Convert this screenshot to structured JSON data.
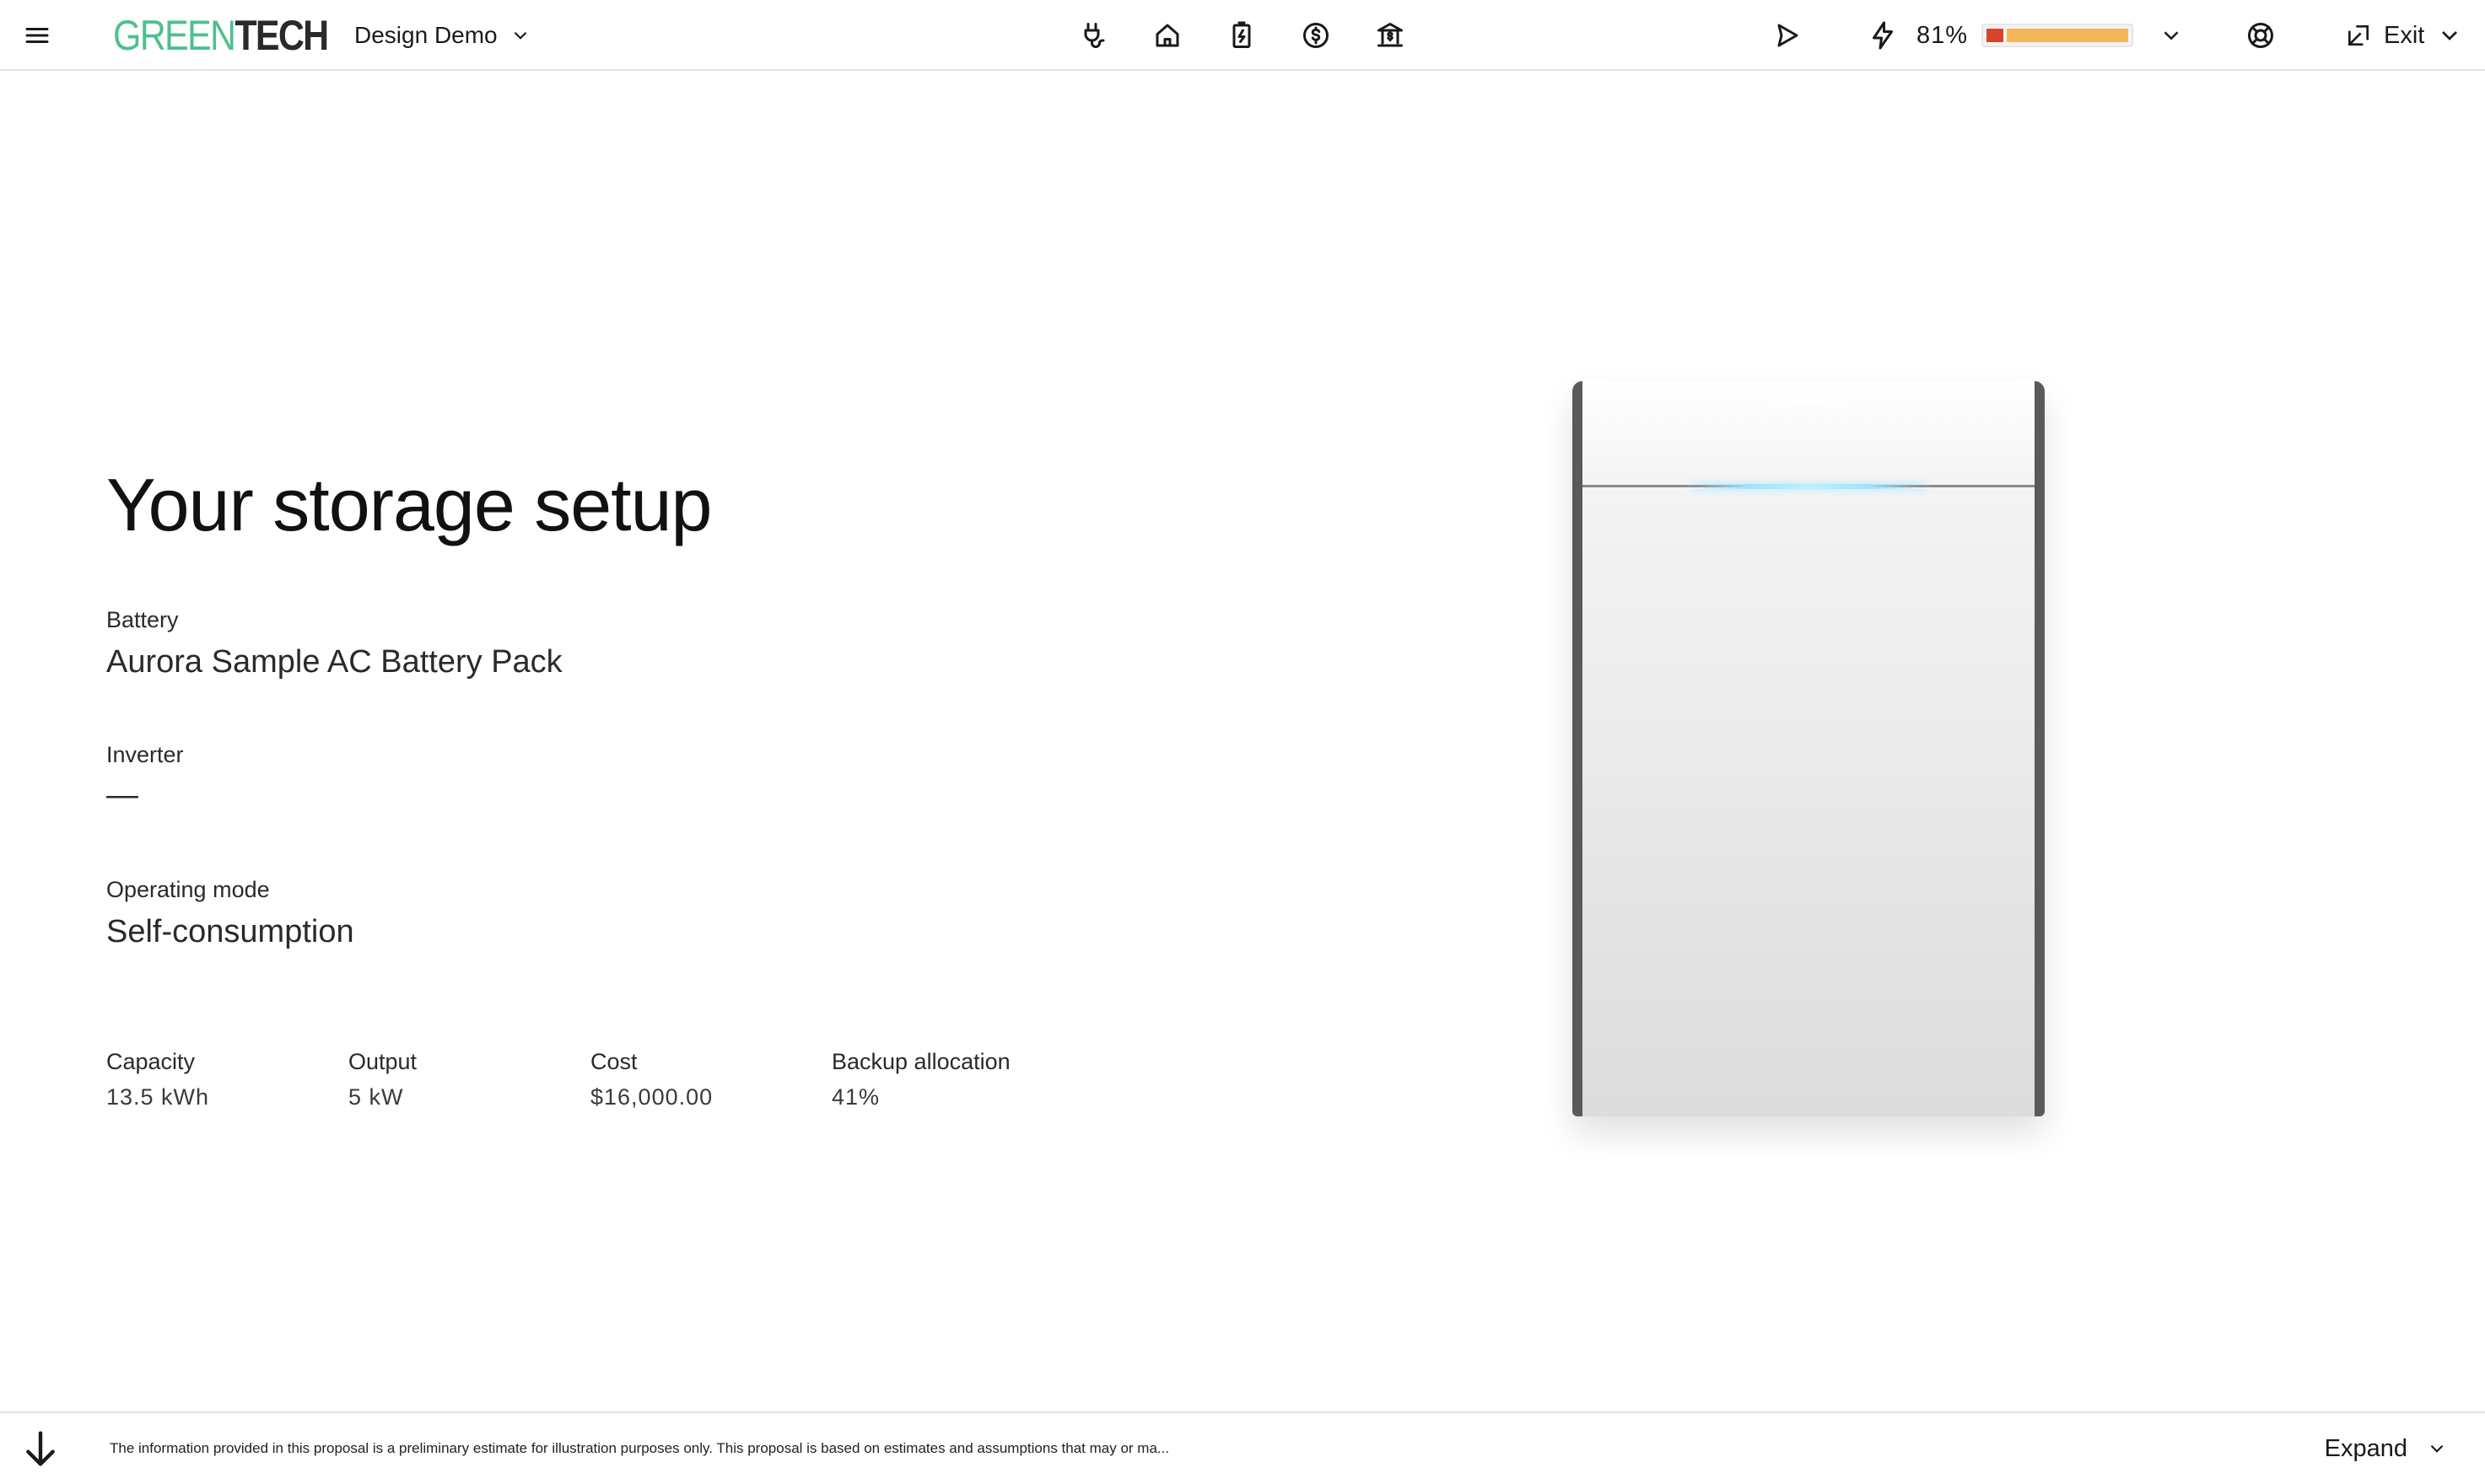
{
  "header": {
    "logo_green": "GREEN",
    "logo_dark": "TECH",
    "project_name": "Design Demo",
    "nav_icons": [
      "plug-icon",
      "home-icon",
      "battery-charge-icon",
      "dollar-circle-icon",
      "bank-icon"
    ],
    "battery_percent": "81%",
    "battery_bar": {
      "red_fraction": 0.12,
      "yellow_fraction": 0.88
    },
    "exit_label": "Exit",
    "colors": {
      "logo_green": "#4fc08d",
      "bar_red": "#d9452b",
      "bar_yellow": "#f4b758"
    }
  },
  "main": {
    "title": "Your storage setup",
    "battery_label": "Battery",
    "battery_value": "Aurora Sample AC Battery Pack",
    "inverter_label": "Inverter",
    "inverter_value": "—",
    "mode_label": "Operating mode",
    "mode_value": "Self-consumption",
    "stats": [
      {
        "label": "Capacity",
        "value": "13.5 kWh"
      },
      {
        "label": "Output",
        "value": "5 kW"
      },
      {
        "label": "Cost",
        "value": "$16,000.00"
      },
      {
        "label": "Backup allocation",
        "value": "41%"
      }
    ]
  },
  "footer": {
    "disclaimer": "The information provided in this proposal is a preliminary estimate for illustration purposes only. This proposal is based on estimates and assumptions that may or ma...",
    "expand_label": "Expand"
  }
}
